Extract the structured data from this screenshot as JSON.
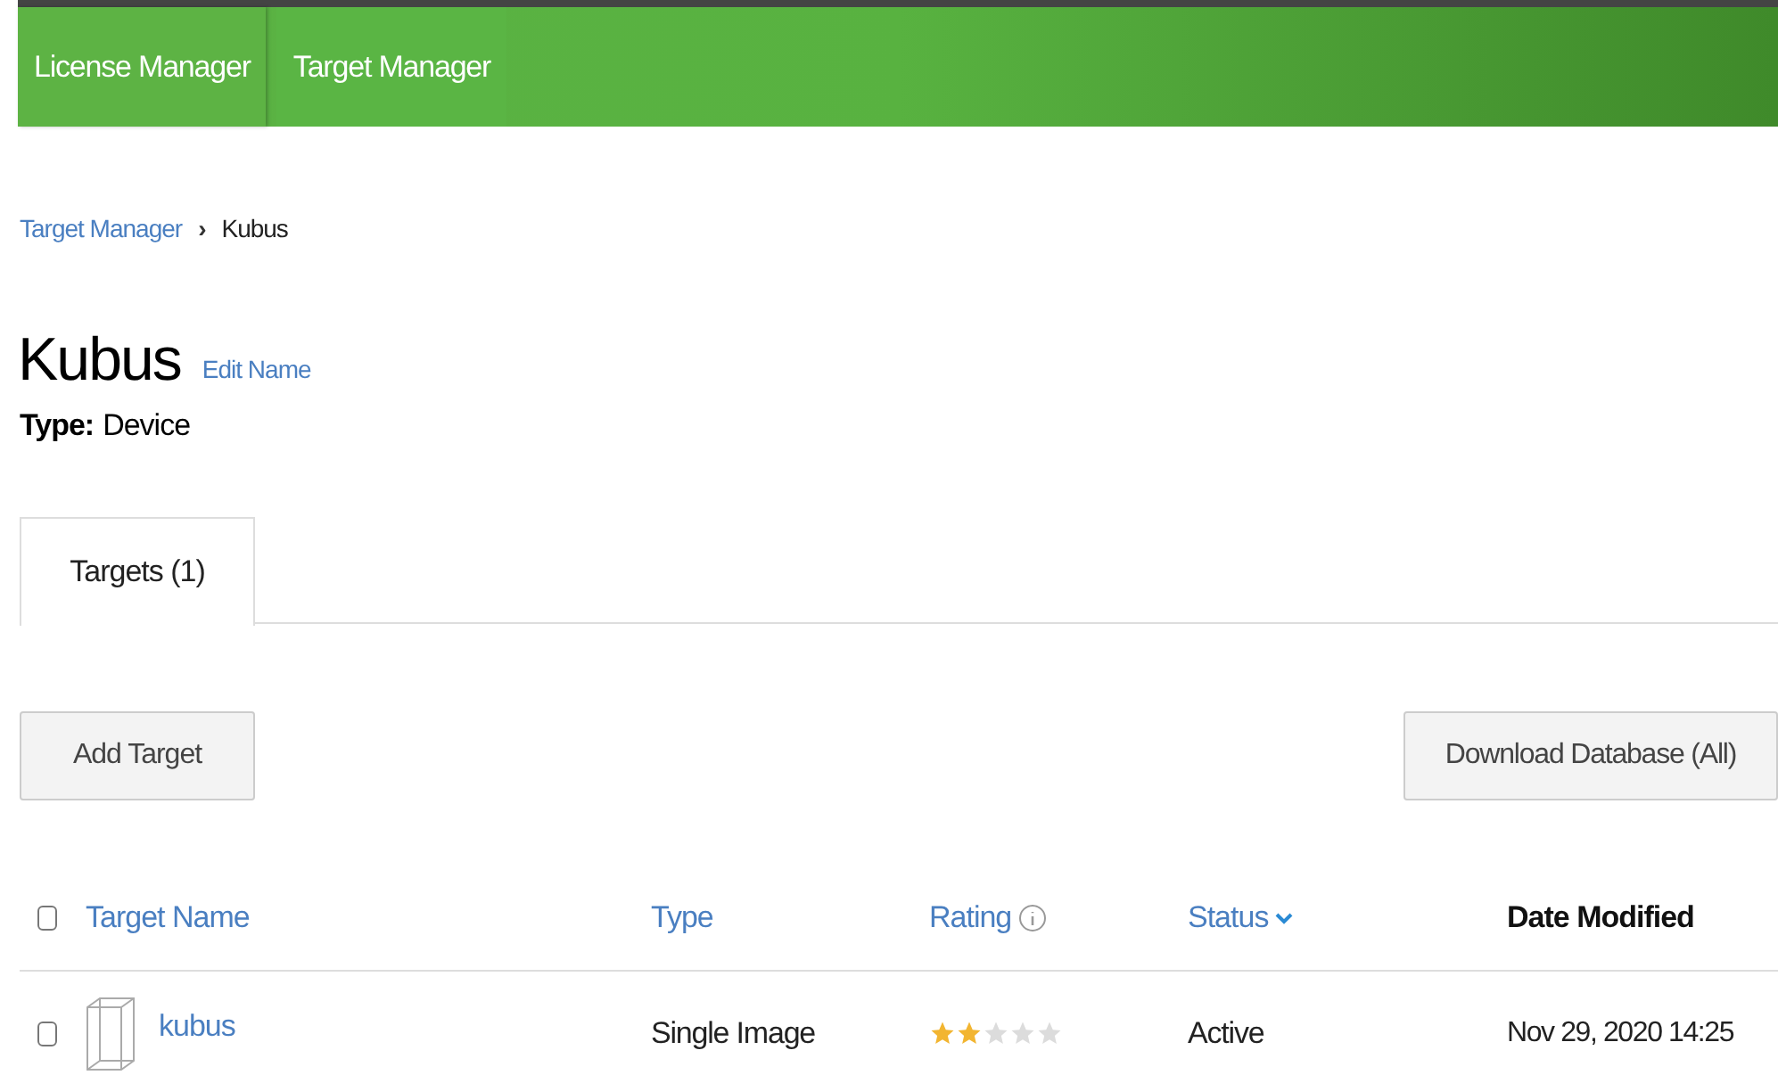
{
  "nav": [
    {
      "label": "License Manager",
      "selected": false
    },
    {
      "label": "Target Manager",
      "selected": true
    }
  ],
  "breadcrumb": {
    "link": "Target Manager",
    "separator": "›",
    "current": "Kubus"
  },
  "title": "Kubus",
  "edit_link": "Edit Name",
  "type_label": "Type:",
  "type_value": "Device",
  "tabs": [
    {
      "label": "Targets (1)",
      "selected": true
    }
  ],
  "buttons": {
    "add": "Add Target",
    "download": "Download Database (All)"
  },
  "table": {
    "select_all_checked": false,
    "columns": [
      {
        "label": "Target Name",
        "kind": "link"
      },
      {
        "label": "Type",
        "kind": "link"
      },
      {
        "label": "Rating",
        "kind": "info"
      },
      {
        "label": "Status",
        "kind": "sort"
      },
      {
        "label": "Date Modified",
        "kind": "plain"
      }
    ],
    "rows": [
      {
        "checked": false,
        "name": "kubus",
        "type": "Single Image",
        "stars": 2,
        "status": "Active",
        "date": "Nov 29, 2020 14:25"
      }
    ]
  }
}
